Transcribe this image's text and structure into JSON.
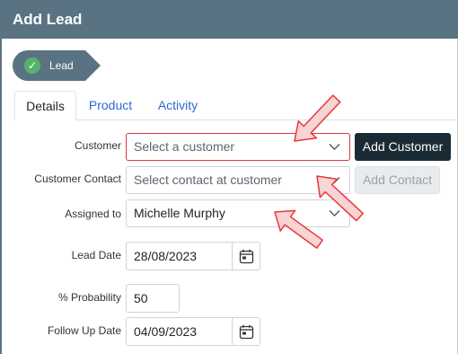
{
  "window": {
    "title": "Add Lead"
  },
  "stage": {
    "label": "Lead",
    "status_icon": "check-circle-icon",
    "color": "#5a7382",
    "check_color": "#57b36b"
  },
  "tabs": [
    {
      "label": "Details",
      "active": true
    },
    {
      "label": "Product",
      "active": false
    },
    {
      "label": "Activity",
      "active": false
    }
  ],
  "form": {
    "customer": {
      "label": "Customer",
      "placeholder": "Select a customer",
      "value": "",
      "invalid": true
    },
    "add_customer_button": "Add Customer",
    "customer_contact": {
      "label": "Customer Contact",
      "placeholder": "Select contact at customer",
      "value": ""
    },
    "add_contact_button": "Add Contact",
    "assigned_to": {
      "label": "Assigned to",
      "value": "Michelle Murphy"
    },
    "lead_date": {
      "label": "Lead Date",
      "value": "28/08/2023"
    },
    "probability": {
      "label": "% Probability",
      "value": "50"
    },
    "follow_up_date": {
      "label": "Follow Up Date",
      "value": "04/09/2023"
    }
  },
  "annotations": {
    "arrow_color": "#e8373a",
    "arrow_fill": "#f8d4d4",
    "arrow_count": 3
  },
  "colors": {
    "header_bg": "#5a7382",
    "link": "#2a6ad3",
    "primary_button": "#1b2b36",
    "invalid_border": "#dc3545"
  }
}
